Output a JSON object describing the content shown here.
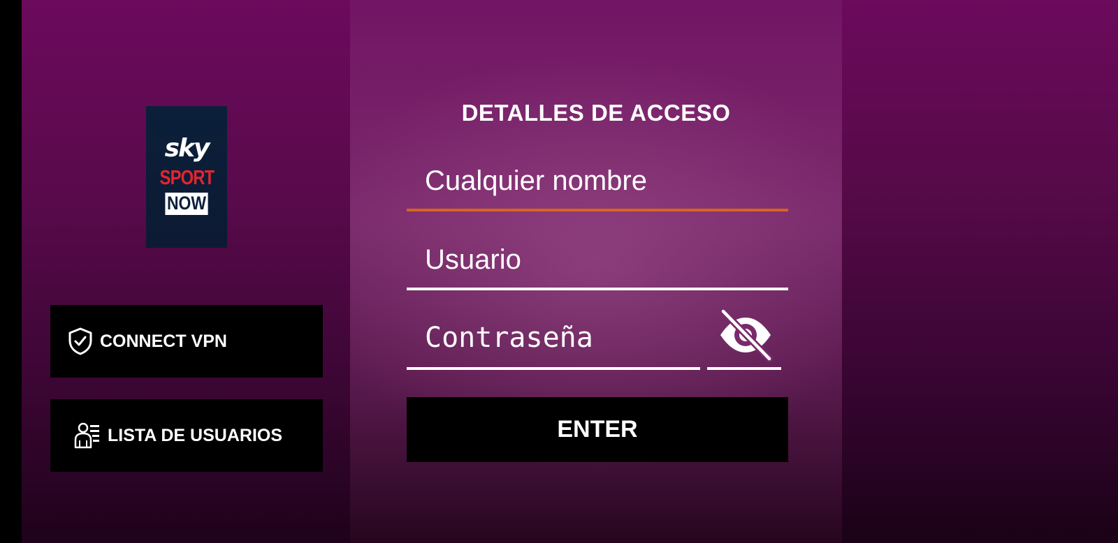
{
  "logo": {
    "line1": "sky",
    "line2": "SPORT",
    "line3": "NOW"
  },
  "sidebar": {
    "vpn_button": {
      "label": "CONNECT VPN",
      "icon": "shield-check-icon"
    },
    "users_button": {
      "label": "LISTA DE USUARIOS",
      "icon": "user-list-icon"
    }
  },
  "form": {
    "title": "DETALLES DE ACCESO",
    "name_field": {
      "placeholder": "Cualquier nombre",
      "value": ""
    },
    "user_field": {
      "placeholder": "Usuario",
      "value": ""
    },
    "password_field": {
      "placeholder": "Contraseña",
      "value": ""
    },
    "toggle_visibility_icon": "eye-off-icon",
    "enter_button": {
      "label": "ENTER"
    }
  },
  "colors": {
    "background": "#6c0a5c",
    "focused_underline": "#d8641f",
    "underline": "#ffffff",
    "button_bg": "#000000",
    "text": "#ffffff",
    "logo_red": "#e3252f",
    "logo_navy": "#0b1f3a"
  }
}
